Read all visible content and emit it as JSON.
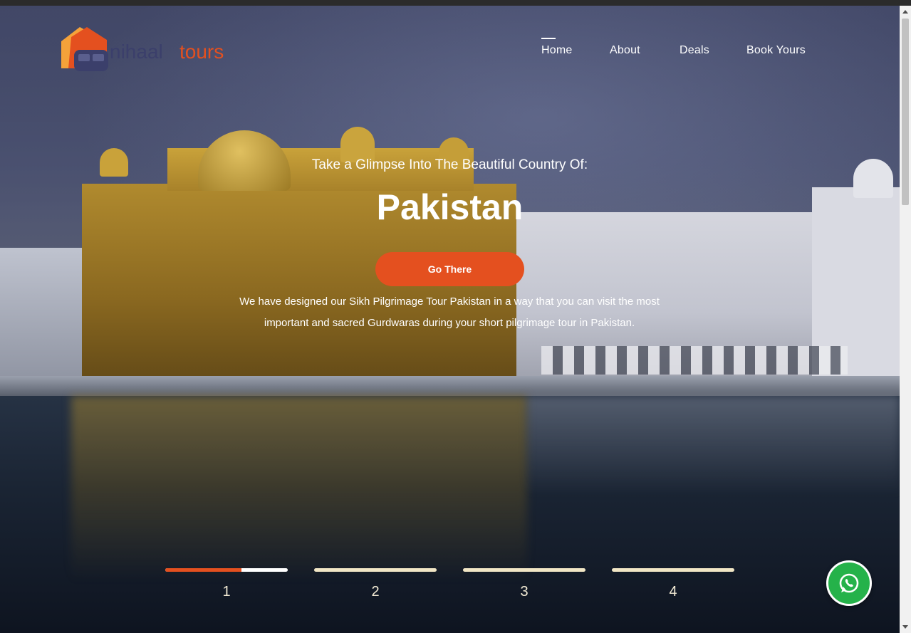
{
  "brand": {
    "logo_text_1": "nihaal",
    "logo_text_2": "tours",
    "logo_color": "#e4501f",
    "logo_dark": "#3b3f6b"
  },
  "nav": {
    "items": [
      {
        "label": "Home",
        "active": true
      },
      {
        "label": "About",
        "active": false
      },
      {
        "label": "Deals",
        "active": false
      },
      {
        "label": "Book Yours",
        "active": false
      }
    ]
  },
  "hero": {
    "tagline": "Take a Glimpse Into The Beautiful Country Of:",
    "headline": "Pakistan",
    "cta_label": "Go There",
    "description": "We have designed our Sikh Pilgrimage Tour Pakistan in a way that you can visit the most important and sacred Gurdwaras during your short pilgrimage tour in Pakistan."
  },
  "slider": {
    "slides": [
      {
        "label": "1",
        "active": true,
        "progress": 0.62
      },
      {
        "label": "2",
        "active": false,
        "progress": 0
      },
      {
        "label": "3",
        "active": false,
        "progress": 0
      },
      {
        "label": "4",
        "active": false,
        "progress": 0
      }
    ]
  },
  "whatsapp": {
    "icon": "whatsapp-icon",
    "color": "#25b24a"
  },
  "colors": {
    "accent": "#e4501f",
    "pager_inactive": "#f1e6c5"
  }
}
